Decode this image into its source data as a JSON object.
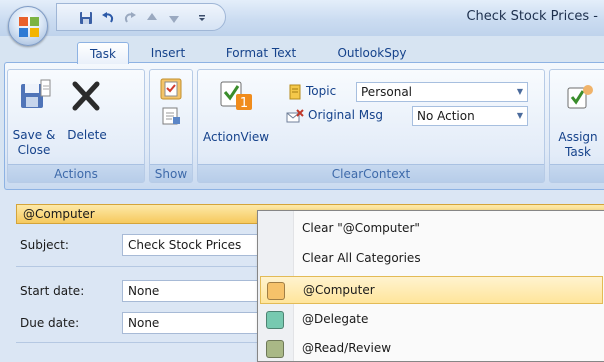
{
  "window": {
    "title": "Check Stock Prices -"
  },
  "tabs": [
    "Task",
    "Insert",
    "Format Text",
    "OutlookSpy"
  ],
  "ribbon": {
    "actions": {
      "label": "Actions",
      "save_close": "Save &\nClose",
      "delete": "Delete"
    },
    "show": {
      "label": "Show"
    },
    "clearcontext": {
      "label": "ClearContext",
      "actionview": "ActionView",
      "topic_label": "Topic",
      "topic_value": "Personal",
      "original_msg_label": "Original Msg",
      "original_msg_value": "No Action"
    },
    "assign": {
      "label": "Assign\nTask"
    }
  },
  "form": {
    "category": "@Computer",
    "subject_label": "Subject:",
    "subject_value": "Check Stock Prices",
    "start_label": "Start date:",
    "start_value": "None",
    "due_label": "Due date:",
    "due_value": "None"
  },
  "menu": {
    "clear_category": "Clear \"@Computer\"",
    "clear_all": "Clear All Categories",
    "categories": [
      {
        "name": "@Computer",
        "color": "#f6c26a"
      },
      {
        "name": "@Delegate",
        "color": "#77c9b0"
      },
      {
        "name": "@Read/Review",
        "color": "#a9b886"
      }
    ]
  },
  "colors": {
    "accent": "#15428b",
    "highlight": "#ffe59b"
  }
}
